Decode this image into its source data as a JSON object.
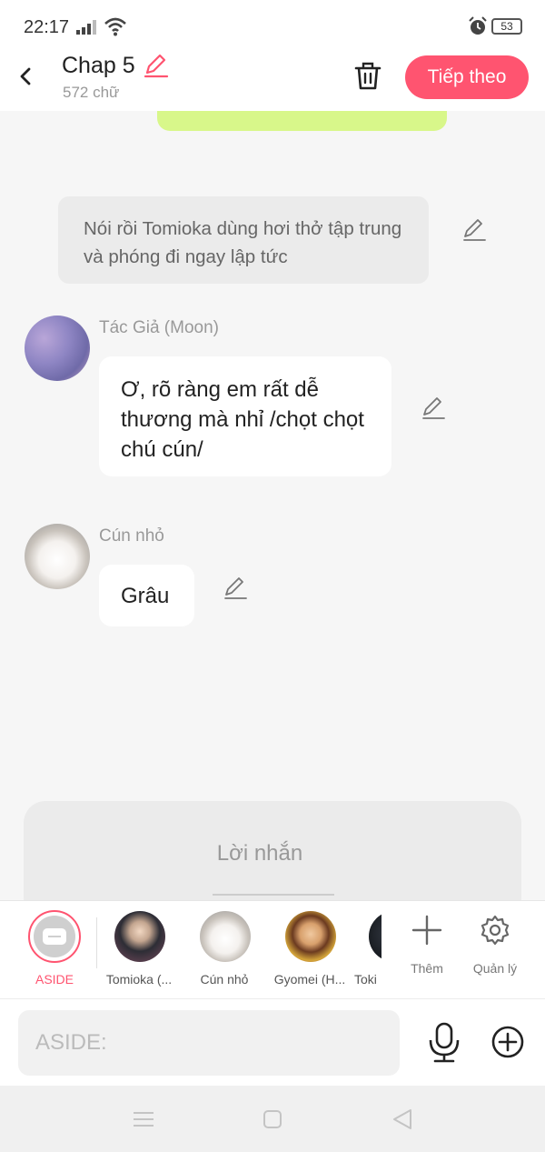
{
  "status_bar": {
    "time": "22:17",
    "battery": "53"
  },
  "header": {
    "title": "Chap 5",
    "word_count": "572 chữ",
    "next_label": "Tiếp theo"
  },
  "colors": {
    "accent": "#ff5470",
    "chat_bg": "#f6f6f6",
    "green_bubble": "#d8f78a"
  },
  "chat": {
    "narration": "Nói rồi Tomioka dùng hơi thở tập trung và phóng đi ngay lập tức",
    "messages": [
      {
        "sender": "Tác Giả (Moon)",
        "text": "Ơ, rõ ràng em rất dễ thương mà nhỉ /chọt chọt chú cún/"
      },
      {
        "sender": "Cún nhỏ",
        "text": "Grâu"
      }
    ]
  },
  "message_panel": {
    "placeholder": "Lời nhắn"
  },
  "characters": [
    {
      "label": "ASIDE"
    },
    {
      "label": "Tomioka (..."
    },
    {
      "label": "Cún nhỏ"
    },
    {
      "label": "Gyomei (H..."
    },
    {
      "label": "Toki"
    }
  ],
  "tools": {
    "add_label": "Thêm",
    "manage_label": "Quản lý"
  },
  "input": {
    "placeholder": "ASIDE:"
  },
  "icons": [
    "signal-icon",
    "wifi-icon",
    "alarm-icon",
    "back-icon",
    "pencil-icon",
    "trash-icon",
    "plus-icon",
    "gear-icon",
    "mic-icon",
    "add-circle-icon",
    "menu-icon",
    "home-icon",
    "back-triangle-icon"
  ]
}
